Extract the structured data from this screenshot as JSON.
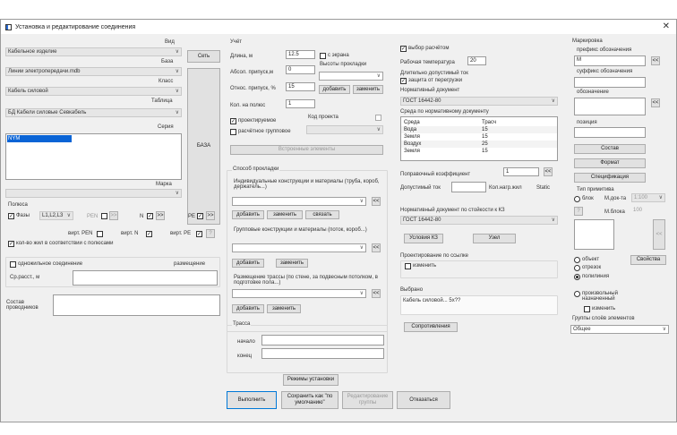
{
  "window": {
    "title": "Установка и редактирование соединения",
    "close": "✕"
  },
  "left": {
    "vid_label": "Вид",
    "vid_value": "Кабельное изделие",
    "baza_label": "База",
    "baza_value": "Линии электропередачи.mdb",
    "klass_label": "Класс",
    "klass_value": "Кабель силовой",
    "table_label": "Таблица",
    "table_value": "БД Кабели силовые Севкабель",
    "seriya_label": "Серия",
    "seriya_selected": "NYM",
    "marka_label": "Марка",
    "set_button": "Сеть",
    "baza_button": "БАЗА",
    "poles_label": "Полюса",
    "phases_label": "Фазы",
    "phases_value": "L1,L2,L3",
    "pen_label": "PEN",
    "pen_btn": ">>",
    "n_label": "N",
    "n_btn": ">>",
    "pe_label": "PE",
    "pe_btn": ">>",
    "virt_pen": "вирт. PEN",
    "virt_n": "вирт. N",
    "virt_pe": "вирт. PE",
    "virt_pe_btn": "?",
    "kolvo_label": "кол-во жил в соответствии с полюсами",
    "single_core_label": "одножильное соединение",
    "placement_label": "размещение",
    "cp_label": "Ср.расст., м",
    "sostav_label": "Состав проводников"
  },
  "mid": {
    "uchet_title": "Учёт",
    "dlina_label": "Длина, м",
    "dlina_value": "12.5",
    "s_ekrana": "с экрана",
    "vysoty_label": "Высоты прокладки",
    "abs_label": "Абсол. припуск,м",
    "abs_value": "0",
    "otn_label": "Относ. припуск, %",
    "otn_value": "15",
    "add_btn": "добавить",
    "change_btn": "заменить",
    "kol_label": "Кол. на полюс",
    "kol_value": "1",
    "proekt_label": "проектируемое",
    "kod_label": "Код проекта",
    "raschet_group": "расчётное групповое",
    "embedded_btn": "Встроенные элементы",
    "sposob_title": "Способ прокладки",
    "indiv_label": "Индивидуальные конструкции и материалы (труба, короб, держатель...)",
    "btn_add": "добавить",
    "btn_change": "заменить",
    "btn_link": "связать",
    "group_label": "Групповые конструкции и материалы (поток, короб...)",
    "btn_add2": "добавить",
    "btn_change2": "заменить",
    "razm_label": "Размещение трассы (по стене, за подвесным потолком, в подготовке пола...)",
    "btn_add3": "добавить",
    "btn_change3": "заменить",
    "trassa_title": "Трасса",
    "nachalo": "начало",
    "konec": "конец",
    "chev": "<<"
  },
  "right": {
    "vybor_label": "выбор расчётом",
    "rab_temp_label": "Рабочая температура",
    "rab_temp_value": "20",
    "dlit_label": "Длительно допустимый ток",
    "zashita_label": "защита от перегрузки",
    "norm_label": "Нормативный документ",
    "norm_value": "ГОСТ 16442-80",
    "sreda_label": "Среда по нормативному документу",
    "env_header": [
      "Среда",
      "Трасч"
    ],
    "env_rows": [
      [
        "Вода",
        "15"
      ],
      [
        "Земля",
        "15"
      ],
      [
        "Воздух",
        "25"
      ],
      [
        "Земля",
        "15"
      ]
    ],
    "popr_label": "Поправочный коэффициент",
    "popr_value": "1",
    "dop_tok_label": "Допустимый ток",
    "kol_nagr_label": "Кол.нагр.жил",
    "static_label": "Static",
    "kz_label": "Нормативный документ по стойкости к КЗ",
    "kz_value": "ГОСТ 16442-80",
    "usl_kz_btn": "Условия КЗ",
    "uzel_btn": "Узел",
    "ssylka_label": "Проектирование по ссылке",
    "izmenit_label": "изменить",
    "vybrano_label": "Выбрано",
    "vybrano_value": "Кабель силовой... 5х??",
    "soprot_btn": "Сопротивления",
    "chev": "<<"
  },
  "far": {
    "mark_title": "Маркировка",
    "prefix_label": "префикс обозначения",
    "prefix_value": "М",
    "suffix_label": "суффикс обозначения",
    "oboz_label": "обозначение",
    "poz_label": "позиция",
    "sostav_btn": "Состав",
    "format_btn": "Формат",
    "spec_btn": "Спецификация",
    "tip_label": "Тип примитива",
    "blok_label": "блок",
    "m_doc_label": "М.док-та",
    "m_doc_value": "1:100",
    "q_btn": "?",
    "m_blok_label": "М.блока",
    "m_blok_value": "100",
    "obekt_label": "объект",
    "svoistva_btn": "Свойства",
    "otrezok_label": "отрезок",
    "polyline_label": "полилиния",
    "proizv_label": "произвольный назначенный",
    "izm_label": "изменить",
    "layers_label": "Группы слоёв элементов",
    "layers_value": "Общее",
    "chev": "<<"
  },
  "bottom": {
    "modes_btn": "Режимы установки",
    "run_btn": "Выполнить",
    "save_default_btn": "Сохранить как \"по умолчанию\"",
    "edit_group_btn": "Редактирование группы",
    "cancel_btn": "Отказаться"
  }
}
